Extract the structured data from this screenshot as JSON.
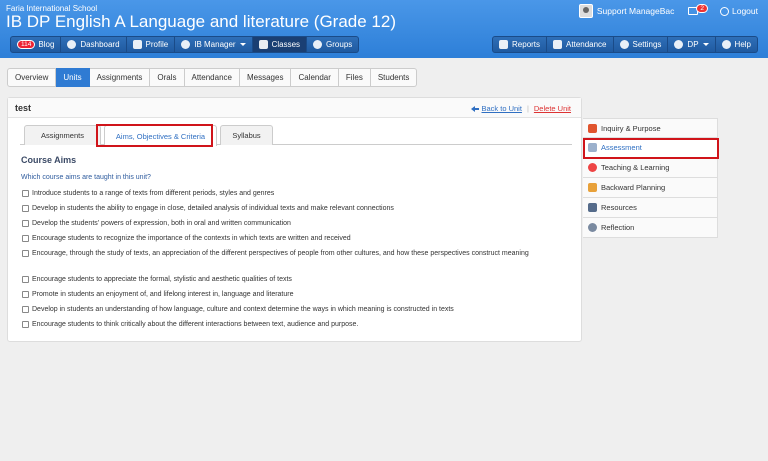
{
  "header": {
    "school": "Faria International School",
    "course_title": "IB DP English A Language and literature (Grade 12)",
    "user_name": "Support ManageBac",
    "message_count": "2",
    "logout_label": "Logout"
  },
  "nav_left": [
    {
      "label": "Blog",
      "badge": "114",
      "icon": "blog-icon"
    },
    {
      "label": "Dashboard",
      "icon": "dashboard-icon"
    },
    {
      "label": "Profile",
      "icon": "profile-icon"
    },
    {
      "label": "IB Manager",
      "icon": "globe-icon",
      "dropdown": true
    },
    {
      "label": "Classes",
      "icon": "classes-icon",
      "active": true
    },
    {
      "label": "Groups",
      "icon": "groups-icon"
    }
  ],
  "nav_right": [
    {
      "label": "Reports",
      "icon": "reports-icon"
    },
    {
      "label": "Attendance",
      "icon": "attendance-icon"
    },
    {
      "label": "Settings",
      "icon": "gear-icon"
    },
    {
      "label": "DP",
      "icon": "search-icon",
      "dropdown": true
    },
    {
      "label": "Help",
      "icon": "help-icon"
    }
  ],
  "class_tabs": [
    "Overview",
    "Units",
    "Assignments",
    "Orals",
    "Attendance",
    "Messages",
    "Calendar",
    "Files",
    "Students"
  ],
  "active_class_tab": "Units",
  "unit": {
    "title": "test",
    "back_label": "Back to Unit",
    "delete_label": "Delete Unit"
  },
  "sub_tabs": [
    "Assignments",
    "Aims, Objectives & Criteria",
    "Syllabus"
  ],
  "active_sub_tab": "Aims, Objectives & Criteria",
  "course_aims": {
    "title": "Course Aims",
    "question": "Which course aims are taught in this unit?",
    "items": [
      "Introduce students to a range of texts from different periods, styles and genres",
      "Develop in students the ability to engage in close, detailed analysis of individual texts and make relevant connections",
      "Develop the students' powers of expression, both in oral and written communication",
      "Encourage students to recognize the importance of the contexts in which texts are written and received",
      "Encourage, through the study of texts, an appreciation of the different perspectives of people from other cultures, and how these perspectives construct meaning",
      "Encourage students to appreciate the formal, stylistic and aesthetic qualities of texts",
      "Promote in students an enjoyment of, and lifelong interest in, language and literature",
      "Develop in students an understanding of how language, culture and context determine the ways in which meaning is constructed in texts",
      "Encourage students to think critically about the different interactions between text, audience and purpose."
    ]
  },
  "side_menu": [
    {
      "label": "Inquiry & Purpose",
      "icon": "inquiry-icon",
      "color": "#e0542e"
    },
    {
      "label": "Assessment",
      "icon": "assessment-icon",
      "color": "#9bb0cc",
      "active": true
    },
    {
      "label": "Teaching & Learning",
      "icon": "teaching-icon",
      "color": "#e44"
    },
    {
      "label": "Backward Planning",
      "icon": "planning-icon",
      "color": "#e8a13a"
    },
    {
      "label": "Resources",
      "icon": "resources-icon",
      "color": "#556b8a"
    },
    {
      "label": "Reflection",
      "icon": "reflection-icon",
      "color": "#7a8aa0"
    }
  ],
  "colors": {
    "header": "#3a8be0",
    "accent": "#2f7bd3",
    "highlight": "#d0141a",
    "link": "#2f6fc2",
    "danger": "#d33333"
  }
}
